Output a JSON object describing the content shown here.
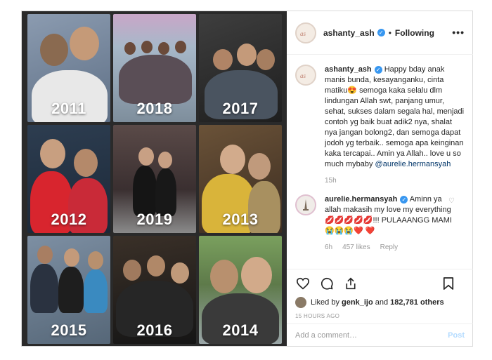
{
  "post": {
    "photos": [
      {
        "year": "2011",
        "bg": "#7a8aa0"
      },
      {
        "year": "2018",
        "bg": "#9aa6b2"
      },
      {
        "year": "2017",
        "bg": "#3a3a3a"
      },
      {
        "year": "2012",
        "bg": "#2b3a4d"
      },
      {
        "year": "2019",
        "bg": "#4a3b3a"
      },
      {
        "year": "2013",
        "bg": "#5b4633"
      },
      {
        "year": "2015",
        "bg": "#6f7f90"
      },
      {
        "year": "2016",
        "bg": "#2a2a2a"
      },
      {
        "year": "2014",
        "bg": "#6b8a5a"
      }
    ]
  },
  "header": {
    "username": "ashanty_ash",
    "separator": "•",
    "follow_label": "Following",
    "more_label": "•••"
  },
  "caption": {
    "username": "ashanty_ash",
    "text": "Happy bday anak manis bunda, kesayanganku, cinta matiku😍 semoga kaka selalu dlm lindungan Allah swt, panjang umur, sehat, sukses dalam segala hal, menjadi contoh yg baik buat adik2 nya, shalat nya jangan bolong2, dan semoga dapat jodoh yg terbaik.. semoga apa keinginan kaka tercapai.. Amin ya Allah.. love u so much mybaby",
    "mention": "@aurelie.hermansyah",
    "age": "15h"
  },
  "reply": {
    "username": "aurelie.hermansyah",
    "text": "Aminn ya allah makasih my love my everything💋💋💋💋💋!!! PULAAANGG MAMI😭😭😭❤️ ❤️",
    "age": "6h",
    "likes": "457 likes",
    "reply_label": "Reply"
  },
  "likes": {
    "text_prefix": "Liked by",
    "liker": "genk_ijo",
    "text_suffix": "and",
    "count": "182,781 others"
  },
  "timestamp": "15 HOURS AGO",
  "comment_box": {
    "placeholder": "Add a comment…",
    "post_label": "Post"
  },
  "colors": {
    "verified": "#3897f0",
    "mention": "#003569",
    "post_disabled": "#b3dbff"
  }
}
